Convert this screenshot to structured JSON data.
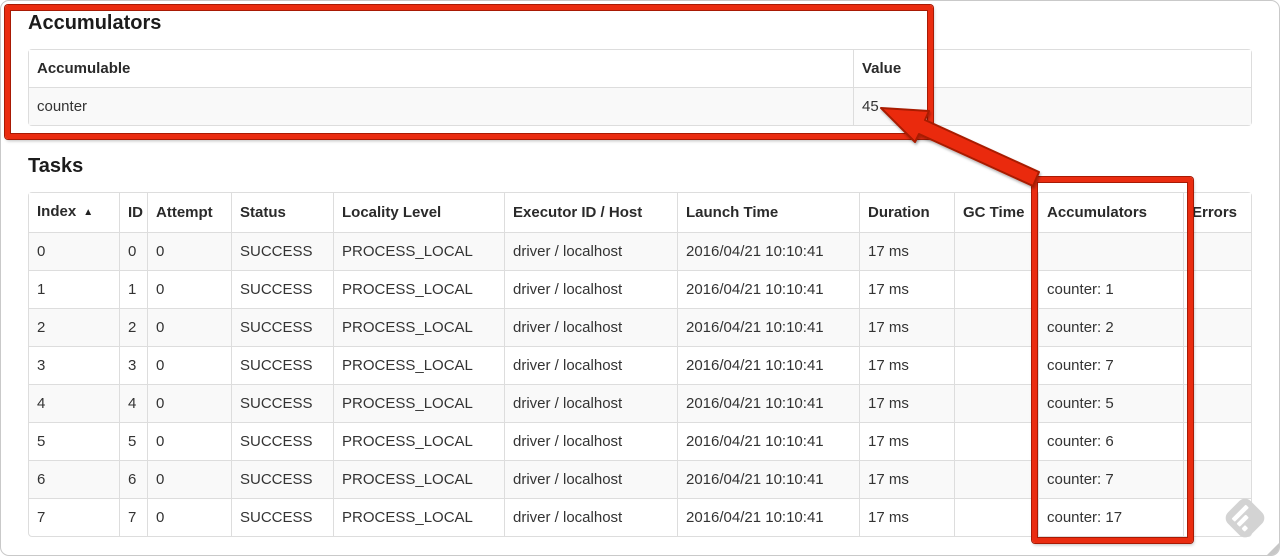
{
  "accumulators_section": {
    "title": "Accumulators",
    "table": {
      "headers": [
        "Accumulable",
        "Value"
      ],
      "row_keys": [
        "accumulable",
        "value"
      ],
      "rows": [
        {
          "accumulable": "counter",
          "value": "45"
        }
      ]
    }
  },
  "tasks_section": {
    "title": "Tasks",
    "table": {
      "headers": [
        "Index",
        "ID",
        "Attempt",
        "Status",
        "Locality Level",
        "Executor ID / Host",
        "Launch Time",
        "Duration",
        "GC Time",
        "Accumulators",
        "Errors"
      ],
      "sorted_column": "Index",
      "sort_indicator": "▲",
      "row_keys": [
        "index",
        "id",
        "attempt",
        "status",
        "locality",
        "executor",
        "launch",
        "duration",
        "gc",
        "accumulators",
        "errors"
      ],
      "rows": [
        {
          "index": "0",
          "id": "0",
          "attempt": "0",
          "status": "SUCCESS",
          "locality": "PROCESS_LOCAL",
          "executor": "driver / localhost",
          "launch": "2016/04/21 10:10:41",
          "duration": "17 ms",
          "gc": "",
          "accumulators": "",
          "errors": ""
        },
        {
          "index": "1",
          "id": "1",
          "attempt": "0",
          "status": "SUCCESS",
          "locality": "PROCESS_LOCAL",
          "executor": "driver / localhost",
          "launch": "2016/04/21 10:10:41",
          "duration": "17 ms",
          "gc": "",
          "accumulators": "counter: 1",
          "errors": ""
        },
        {
          "index": "2",
          "id": "2",
          "attempt": "0",
          "status": "SUCCESS",
          "locality": "PROCESS_LOCAL",
          "executor": "driver / localhost",
          "launch": "2016/04/21 10:10:41",
          "duration": "17 ms",
          "gc": "",
          "accumulators": "counter: 2",
          "errors": ""
        },
        {
          "index": "3",
          "id": "3",
          "attempt": "0",
          "status": "SUCCESS",
          "locality": "PROCESS_LOCAL",
          "executor": "driver / localhost",
          "launch": "2016/04/21 10:10:41",
          "duration": "17 ms",
          "gc": "",
          "accumulators": "counter: 7",
          "errors": ""
        },
        {
          "index": "4",
          "id": "4",
          "attempt": "0",
          "status": "SUCCESS",
          "locality": "PROCESS_LOCAL",
          "executor": "driver / localhost",
          "launch": "2016/04/21 10:10:41",
          "duration": "17 ms",
          "gc": "",
          "accumulators": "counter: 5",
          "errors": ""
        },
        {
          "index": "5",
          "id": "5",
          "attempt": "0",
          "status": "SUCCESS",
          "locality": "PROCESS_LOCAL",
          "executor": "driver / localhost",
          "launch": "2016/04/21 10:10:41",
          "duration": "17 ms",
          "gc": "",
          "accumulators": "counter: 6",
          "errors": ""
        },
        {
          "index": "6",
          "id": "6",
          "attempt": "0",
          "status": "SUCCESS",
          "locality": "PROCESS_LOCAL",
          "executor": "driver / localhost",
          "launch": "2016/04/21 10:10:41",
          "duration": "17 ms",
          "gc": "",
          "accumulators": "counter: 7",
          "errors": ""
        },
        {
          "index": "7",
          "id": "7",
          "attempt": "0",
          "status": "SUCCESS",
          "locality": "PROCESS_LOCAL",
          "executor": "driver / localhost",
          "launch": "2016/04/21 10:10:41",
          "duration": "17 ms",
          "gc": "",
          "accumulators": "counter: 17",
          "errors": ""
        }
      ]
    }
  },
  "annotations": {
    "red": "#ea2c10",
    "red_dark": "#a81a04"
  },
  "icons": {
    "sort_ascending": "▲",
    "watermark": "skitch-pencil-badge",
    "watermark_color": "#d3d3d3"
  }
}
